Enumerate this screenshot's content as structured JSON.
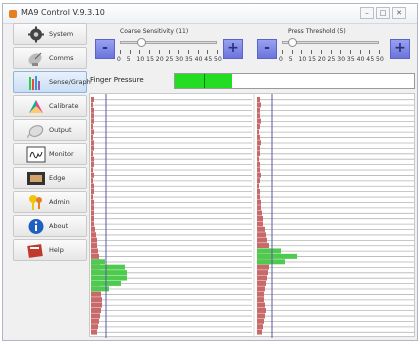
{
  "window": {
    "title": "MA9 Control V.9.3.10",
    "controls": [
      "minimize",
      "maximize",
      "close"
    ]
  },
  "sidebar": {
    "items": [
      {
        "label": "System",
        "icon": "gear-icon"
      },
      {
        "label": "Comms",
        "icon": "satellite-icon"
      },
      {
        "label": "Sense/Graph",
        "icon": "bar-graph-icon",
        "active": true
      },
      {
        "label": "Calibrate",
        "icon": "color-triangle-icon"
      },
      {
        "label": "Output",
        "icon": "mouse-icon"
      },
      {
        "label": "Monitor",
        "icon": "signature-icon"
      },
      {
        "label": "Edge",
        "icon": "frame-icon"
      },
      {
        "label": "Admin",
        "icon": "keys-icon"
      },
      {
        "label": "About",
        "icon": "info-icon"
      },
      {
        "label": "Help",
        "icon": "help-book-icon"
      }
    ]
  },
  "controls": {
    "coarse": {
      "label": "Coarse Sensitivity (11)",
      "value": 11,
      "min": 0,
      "max": 50,
      "ticks": [
        "0",
        "5",
        "10",
        "15",
        "20",
        "25",
        "30",
        "35",
        "40",
        "45",
        "50"
      ],
      "minus": "-",
      "plus": "+"
    },
    "press": {
      "label": "Press Threshold (5)",
      "value": 5,
      "min": 0,
      "max": 50,
      "ticks": [
        "0",
        "5",
        "10",
        "15",
        "20",
        "25",
        "30",
        "35",
        "40",
        "45",
        "50"
      ],
      "minus": "-",
      "plus": "+"
    }
  },
  "finger_pressure": {
    "label": "Finger Pressure",
    "level": 0.24,
    "color": "#22dd22"
  },
  "graphs": {
    "row_count": 44,
    "left": {
      "red": [
        3,
        2,
        3,
        3,
        3,
        2,
        3,
        2,
        3,
        3,
        2,
        3,
        3,
        2,
        3,
        2,
        3,
        3,
        2,
        3,
        3,
        3,
        3,
        3,
        4,
        5,
        6,
        6,
        7,
        8,
        9,
        9,
        8,
        6,
        8,
        9,
        10,
        11,
        11,
        10,
        9,
        8,
        7,
        6
      ],
      "green_rows": [
        30,
        31,
        32,
        33,
        34,
        35
      ],
      "green": [
        14,
        34,
        36,
        36,
        30,
        18
      ]
    },
    "right": {
      "red": [
        3,
        4,
        3,
        3,
        4,
        3,
        2,
        3,
        4,
        3,
        3,
        2,
        3,
        3,
        4,
        3,
        2,
        3,
        3,
        4,
        4,
        5,
        6,
        6,
        8,
        9,
        10,
        12,
        14,
        15,
        14,
        12,
        11,
        10,
        9,
        8,
        7,
        7,
        8,
        9,
        8,
        7,
        6,
        5
      ],
      "green_rows": [
        28,
        29,
        30
      ],
      "green": [
        24,
        40,
        28
      ]
    },
    "colors": {
      "red": "#c96a6a",
      "green": "#4ecb4e",
      "line": "#b5b5b5",
      "axis": "#5a5aa0"
    }
  }
}
